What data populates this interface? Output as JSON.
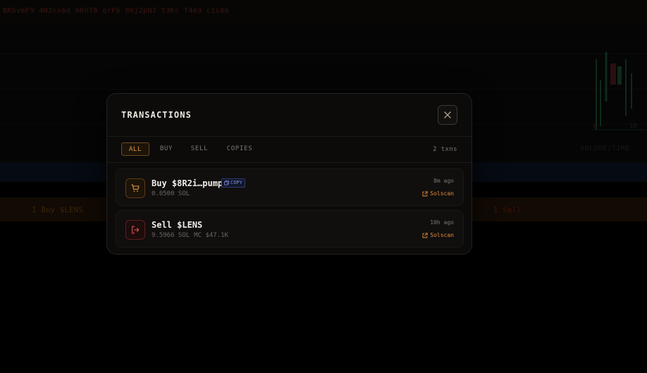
{
  "background": {
    "ticker_text": "BK6vmF9 4N2cxbd m6hT8 qrPb 8Rj2pN7 t3Kc f4m9 c1s8b",
    "buy_label": "1 Buy $LENS",
    "sell_label": "1 Sell",
    "axis_ticks": [
      "0",
      "10"
    ],
    "axis_label": "VOLUME/TIME"
  },
  "modal": {
    "title": "TRANSACTIONS",
    "close_icon": "close-icon",
    "tabs": [
      {
        "label": "ALL",
        "active": true
      },
      {
        "label": "BUY",
        "active": false
      },
      {
        "label": "SELL",
        "active": false
      },
      {
        "label": "COPIES",
        "active": false
      }
    ],
    "txn_count": "2 txns",
    "transactions": [
      {
        "type": "buy",
        "icon": "cart-icon",
        "title": "Buy $8R2i…pump",
        "badge": "COPY",
        "amount": "0.0500 SOL",
        "mc": "",
        "time": "8m ago",
        "link": "Solscan"
      },
      {
        "type": "sell",
        "icon": "exit-icon",
        "title": "Sell $LENS",
        "badge": "",
        "amount": "9.5966 SOL",
        "mc": "MC $47.1K",
        "time": "10h ago",
        "link": "Solscan"
      }
    ]
  },
  "colors": {
    "accent": "#e19a44",
    "link": "#e58a3a",
    "sell": "#d9534f",
    "copy_badge": "#7f92d8"
  }
}
